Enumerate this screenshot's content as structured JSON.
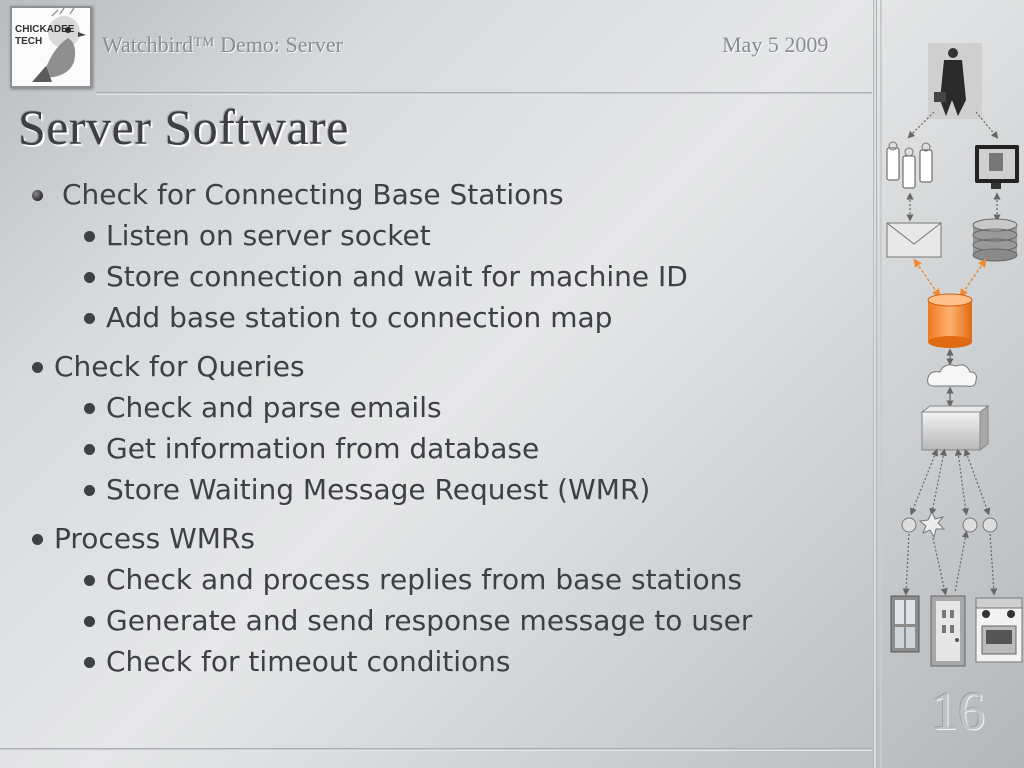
{
  "logo": {
    "line1": "CHICKADEE",
    "line2": "TECH"
  },
  "header": {
    "title": "Watchbird™ Demo: Server",
    "date": "May 5 2009"
  },
  "slide": {
    "title": "Server Software",
    "page_number": "16",
    "bullets": [
      {
        "text": "Check for Connecting Base Stations",
        "sub": [
          "Listen on server socket",
          "Store connection and wait for machine ID",
          "Add base station to connection map"
        ]
      },
      {
        "text": "Check for Queries",
        "sub": [
          "Check and parse emails",
          "Get information from database",
          "Store Waiting Message Request (WMR)"
        ]
      },
      {
        "text": "Process WMRs",
        "sub": [
          "Check and process replies from base stations",
          "Generate and send response message to user",
          "Check for timeout conditions"
        ]
      }
    ]
  },
  "diagram": {
    "icons": [
      "person-photo-icon",
      "mobile-devices-icon",
      "computer-monitor-icon",
      "envelope-icon",
      "database-icon",
      "server-cylinder-icon",
      "cloud-icon",
      "base-station-box-icon",
      "sensor-node-icon",
      "window-icon",
      "door-icon",
      "stove-icon"
    ],
    "accent": "#f08a30"
  }
}
